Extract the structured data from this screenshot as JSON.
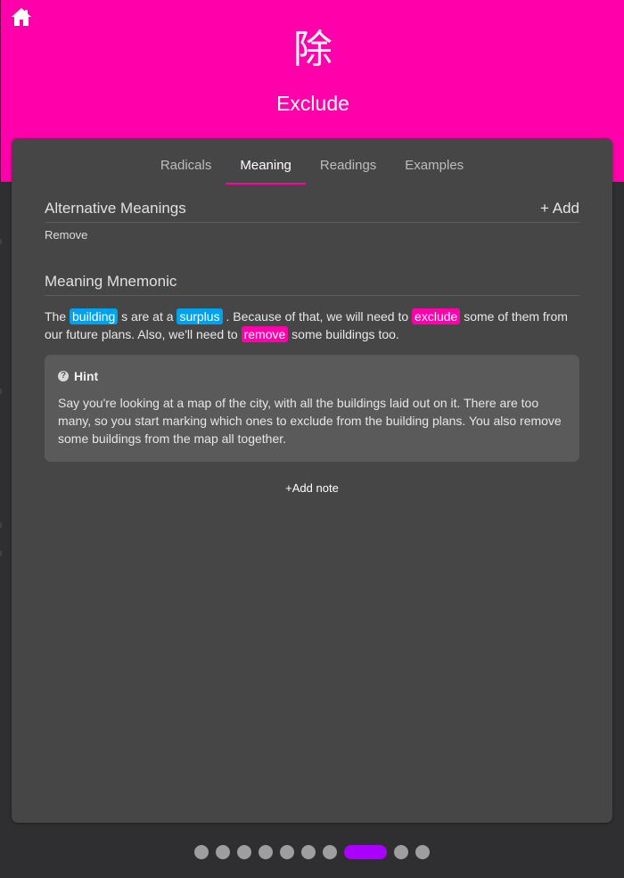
{
  "header": {
    "kanji": "除",
    "meaning": "Exclude",
    "home_icon": "home-icon",
    "accent_color": "#ff00aa"
  },
  "tabs": [
    {
      "label": "Radicals",
      "active": false
    },
    {
      "label": "Meaning",
      "active": true
    },
    {
      "label": "Readings",
      "active": false
    },
    {
      "label": "Examples",
      "active": false
    }
  ],
  "alternative_meanings": {
    "title": "Alternative Meanings",
    "add_label": "+ Add",
    "items": [
      "Remove"
    ]
  },
  "mnemonic": {
    "title": "Meaning Mnemonic",
    "parts": {
      "t1": "The ",
      "tag1": "building",
      "t2": " s are at a ",
      "tag2": "surplus",
      "t3": " . Because of that, we will need to ",
      "tag3": "exclude",
      "t4": " some of them from our future plans. Also, we'll need to ",
      "tag4": "remove",
      "t5": " some buildings too."
    }
  },
  "hint": {
    "title": "Hint",
    "icon": "question-circle-icon",
    "body": "Say you're looking at a map of the city, with all the buildings laid out on it. There are too many, so you start marking which ones to exclude from the building plans. You also remove some buildings from the map all together."
  },
  "add_note_label": "+Add note",
  "pager": {
    "total": 10,
    "current": 8
  },
  "colors": {
    "radical_tag": "#00a2ee",
    "kanji_tag": "#ff00aa",
    "active_page": "#aa00ff"
  }
}
